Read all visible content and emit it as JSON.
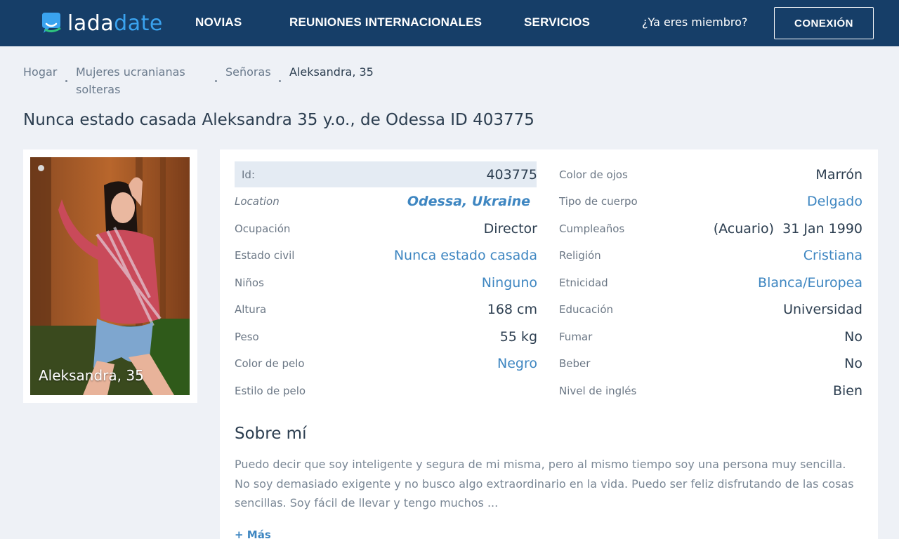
{
  "brand": {
    "part1": "lada",
    "part2": "date"
  },
  "nav": {
    "novias": "NOVIAS",
    "reuniones": "REUNIONES INTERNACIONALES",
    "servicios": "SERVICIOS",
    "member_question": "¿Ya eres miembro?",
    "login": "CONEXIÓN"
  },
  "breadcrumb": {
    "home": "Hogar",
    "category_line1": "Mujeres ucranianas",
    "category_line2": "solteras",
    "ladies": "Señoras",
    "current": "Aleksandra, 35"
  },
  "title": "Nunca estado casada Aleksandra 35 y.o., de Odessa ID 403775",
  "photo": {
    "caption": "Aleksandra, 35"
  },
  "details_left": [
    {
      "label": "Id:",
      "value": "403775"
    },
    {
      "label": "Location",
      "value": "Odessa, Ukraine"
    },
    {
      "label": "Ocupación",
      "value": "Director"
    },
    {
      "label": "Estado civil",
      "value": "Nunca estado casada"
    },
    {
      "label": "Niños",
      "value": "Ninguno"
    },
    {
      "label": "Altura",
      "value": "168 cm"
    },
    {
      "label": "Peso",
      "value": "55 kg"
    },
    {
      "label": "Color de pelo",
      "value": "Negro"
    },
    {
      "label": "Estilo de pelo",
      "value": ""
    }
  ],
  "details_right": [
    {
      "label": "Color de ojos",
      "value": "Marrón"
    },
    {
      "label": "Tipo de cuerpo",
      "value": "Delgado"
    },
    {
      "label": "Cumpleaños",
      "value": "(Acuario)  31 Jan 1990"
    },
    {
      "label": "Religión",
      "value": "Cristiana"
    },
    {
      "label": "Etnicidad",
      "value": "Blanca/Europea"
    },
    {
      "label": "Educación",
      "value": "Universidad"
    },
    {
      "label": "Fumar",
      "value": "No"
    },
    {
      "label": "Beber",
      "value": "No"
    },
    {
      "label": "Nivel de inglés",
      "value": "Bien"
    }
  ],
  "about": {
    "title": "Sobre mí",
    "text": "Puedo decir que soy inteligente y segura de mi misma, pero al mismo tiempo soy una persona muy sencilla. No soy demasiado exigente y no busco algo extraordinario en la vida. Puedo ser feliz disfrutando de las cosas sencillas. Soy fácil de llevar y tengo muchos ...",
    "more": "+ Más"
  },
  "colors": {
    "header_bg": "#163e68",
    "brand_accent": "#3aa3ef",
    "link": "#3e86c1",
    "page_bg": "#eef1f6"
  }
}
